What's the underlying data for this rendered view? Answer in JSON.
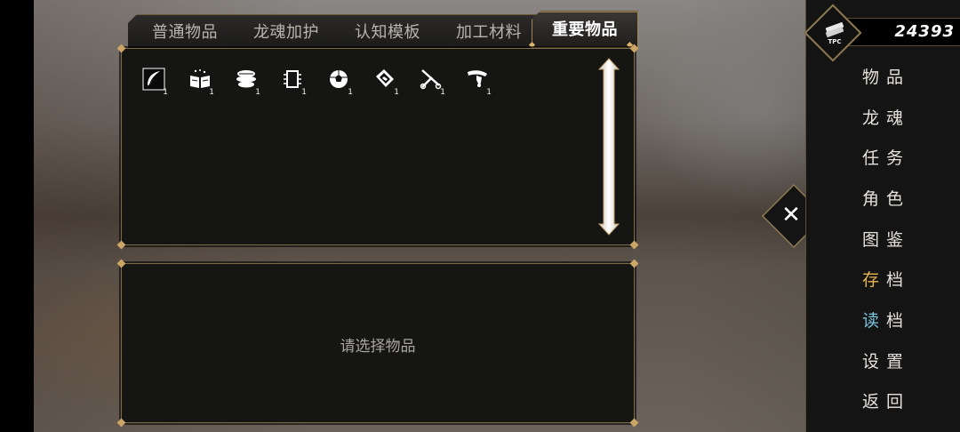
{
  "tabs": [
    {
      "label": "普通物品",
      "active": false
    },
    {
      "label": "龙魂加护",
      "active": false
    },
    {
      "label": "认知模板",
      "active": false
    },
    {
      "label": "加工材料",
      "active": false
    },
    {
      "label": "重要物品",
      "active": true
    }
  ],
  "items": [
    {
      "icon": "feather-icon",
      "count": "1"
    },
    {
      "icon": "book-icon",
      "count": "1"
    },
    {
      "icon": "food-icon",
      "count": "1"
    },
    {
      "icon": "chip-icon",
      "count": "1"
    },
    {
      "icon": "ball-icon",
      "count": "1"
    },
    {
      "icon": "card-icon",
      "count": "1"
    },
    {
      "icon": "scissors-icon",
      "count": "1"
    },
    {
      "icon": "ribbon-icon",
      "count": "1"
    }
  ],
  "description": {
    "placeholder": "请选择物品"
  },
  "currency": {
    "icon": "tpc-coin-icon",
    "label": "TPC",
    "value": "24393"
  },
  "menu": [
    {
      "first": "物",
      "second": "品",
      "key": "items"
    },
    {
      "first": "龙",
      "second": "魂",
      "key": "dragon-soul"
    },
    {
      "first": "任",
      "second": "务",
      "key": "tasks"
    },
    {
      "first": "角",
      "second": "色",
      "key": "characters"
    },
    {
      "first": "图",
      "second": "鉴",
      "key": "codex"
    },
    {
      "first": "存",
      "second": "档",
      "key": "save",
      "accent": "#e8b24a"
    },
    {
      "first": "读",
      "second": "档",
      "key": "load",
      "accent": "#7ac6e0"
    },
    {
      "first": "设",
      "second": "置",
      "key": "settings"
    },
    {
      "first": "返",
      "second": "回",
      "key": "back"
    }
  ],
  "close_icon": "close-icon",
  "colors": {
    "gold_border": "#a08450",
    "panel_bg": "#151514",
    "save_accent": "#e8b24a",
    "load_accent": "#7ac6e0"
  }
}
